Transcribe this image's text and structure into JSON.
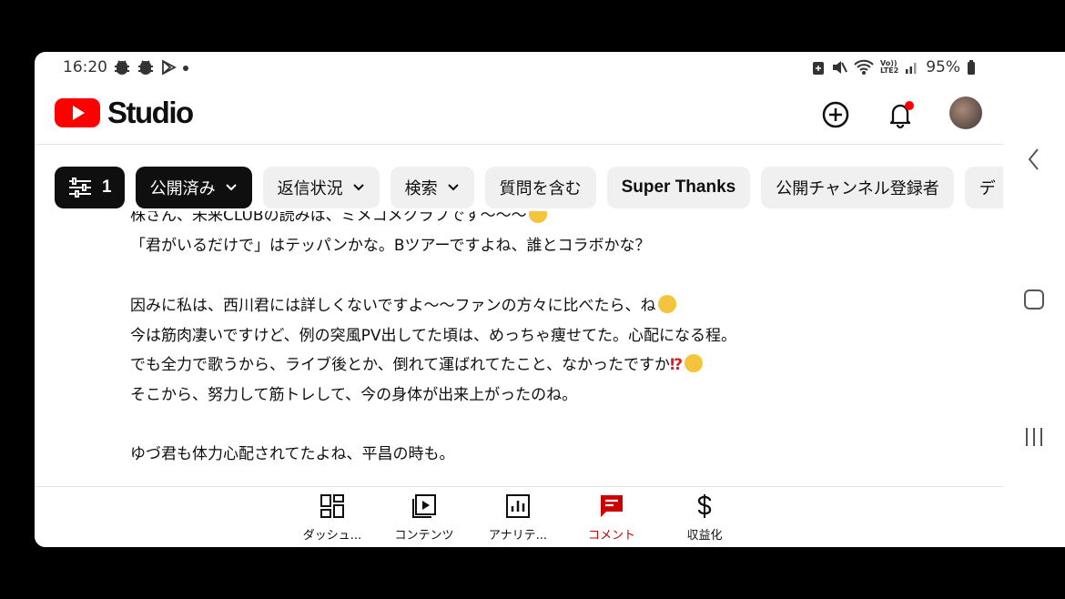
{
  "status_bar": {
    "time": "16:20",
    "left_icons": [
      "bug-notification-icon",
      "bug-notification-icon",
      "play-store-icon",
      "dot-icon"
    ],
    "right_icons": [
      "data-saver-icon",
      "mute-icon",
      "wifi-icon",
      "volte-icon",
      "signal-icon"
    ],
    "volte_label": "Vo))\nLTE2",
    "battery": "95%"
  },
  "app_bar": {
    "logo_text": "Studio",
    "actions": [
      "create-icon",
      "notifications-icon",
      "avatar"
    ]
  },
  "filters": {
    "filter_count": "1",
    "chips": [
      {
        "label": "公開済み",
        "dropdown": true,
        "selected": true
      },
      {
        "label": "返信状況",
        "dropdown": true
      },
      {
        "label": "検索",
        "dropdown": true
      },
      {
        "label": "質問を含む",
        "dropdown": false
      },
      {
        "label": "Super Thanks",
        "dropdown": false
      },
      {
        "label": "公開チャンネル登録者",
        "dropdown": false
      },
      {
        "label": "デ",
        "dropdown": false
      }
    ]
  },
  "comment": {
    "lines": [
      "株さん、未来CLUBの読みは、ミメコメクラフです〜〜〜",
      "「君がいるだけで」はテッパンかな。Bツアーですよね、誰とコラボかな？",
      "",
      "因みに私は、西川君には詳しくないですよ〜〜ファンの方々に比べたら、ね",
      "今は筋肉凄いですけど、例の突風PV出してた頃は、めっちゃ痩せてた。心配になる程。",
      "でも全力で歌うから、ライブ後とか、倒れて運ばれてたこと、なかったですか",
      "そこから、努力して筋トレして、今の身体が出来上がったのね。",
      "",
      "ゆづ君も体力心配されてたよね、平昌の時も。"
    ],
    "exclamation_question": "⁉"
  },
  "bottom_nav": [
    {
      "label": "ダッシュ...",
      "icon": "dashboard-icon",
      "active": false
    },
    {
      "label": "コンテンツ",
      "icon": "content-icon",
      "active": false
    },
    {
      "label": "アナリテ...",
      "icon": "analytics-icon",
      "active": false
    },
    {
      "label": "コメント",
      "icon": "comments-icon",
      "active": true
    },
    {
      "label": "収益化",
      "icon": "monetization-icon",
      "active": false
    }
  ],
  "colors": {
    "accent": "#cc0000",
    "youtube_red": "#ff0000",
    "chip_bg": "#f0f0f0",
    "chip_selected_bg": "#0f0f0f"
  }
}
